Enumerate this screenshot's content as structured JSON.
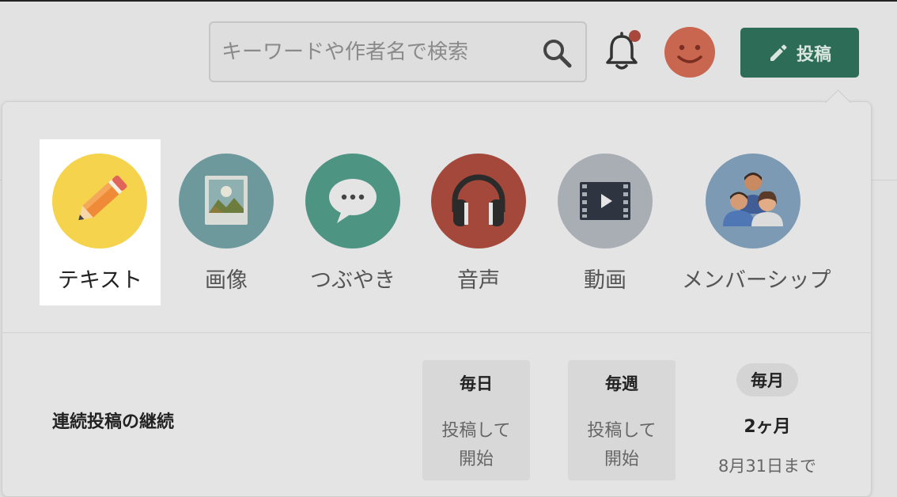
{
  "header": {
    "search": {
      "placeholder": "キーワードや作者名で検索",
      "icon": "search-icon"
    },
    "notifications": {
      "icon": "bell-icon",
      "has_unread": true,
      "dot_color": "#a8483d"
    },
    "avatar": {
      "icon": "smiley-avatar",
      "color": "#c9664f"
    },
    "post_button": {
      "label": "投稿",
      "icon": "pencil-icon",
      "color": "#2d6c57"
    }
  },
  "post_menu": {
    "types": [
      {
        "label": "テキスト",
        "icon": "pencil-icon",
        "color": "#f6d34c",
        "selected": true
      },
      {
        "label": "画像",
        "icon": "picture-icon",
        "color": "#6e999c"
      },
      {
        "label": "つぶやき",
        "icon": "speech-bubble-icon",
        "color": "#4e9483"
      },
      {
        "label": "音声",
        "icon": "headphones-icon",
        "color": "#a4483b"
      },
      {
        "label": "動画",
        "icon": "film-icon",
        "color": "#a9aeb5"
      },
      {
        "label": "メンバーシップ",
        "icon": "people-icon",
        "color": "#7d9ab4"
      }
    ]
  },
  "streak": {
    "title": "連続投稿の継続",
    "daily": {
      "label": "毎日",
      "status_line1": "投稿して",
      "status_line2": "開始"
    },
    "weekly": {
      "label": "毎週",
      "status_line1": "投稿して",
      "status_line2": "開始"
    },
    "monthly": {
      "label": "毎月",
      "value": "2ヶ月",
      "due": "8月31日まで"
    }
  }
}
